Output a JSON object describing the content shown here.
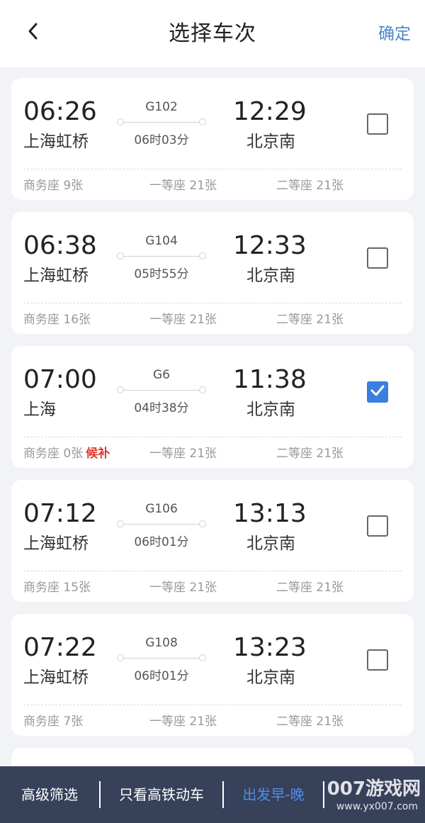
{
  "header": {
    "title": "选择车次",
    "confirm_label": "确定"
  },
  "trains": [
    {
      "dep_time": "06:26",
      "dep_station": "上海虹桥",
      "train_no": "G102",
      "duration": "06时03分",
      "arr_time": "12:29",
      "arr_station": "北京南",
      "checked": false,
      "seats": [
        "商务座 9张",
        "一等座 21张",
        "二等座 21张"
      ]
    },
    {
      "dep_time": "06:38",
      "dep_station": "上海虹桥",
      "train_no": "G104",
      "duration": "05时55分",
      "arr_time": "12:33",
      "arr_station": "北京南",
      "checked": false,
      "seats": [
        "商务座 16张",
        "一等座 21张",
        "二等座 21张"
      ]
    },
    {
      "dep_time": "07:00",
      "dep_station": "上海",
      "train_no": "G6",
      "duration": "04时38分",
      "arr_time": "11:38",
      "arr_station": "北京南",
      "checked": true,
      "seats": [
        "商务座 0张",
        "一等座 21张",
        "二等座 21张"
      ],
      "waitlist": "候补"
    },
    {
      "dep_time": "07:12",
      "dep_station": "上海虹桥",
      "train_no": "G106",
      "duration": "06时01分",
      "arr_time": "13:13",
      "arr_station": "北京南",
      "checked": false,
      "seats": [
        "商务座 15张",
        "一等座 21张",
        "二等座 21张"
      ]
    },
    {
      "dep_time": "07:22",
      "dep_station": "上海虹桥",
      "train_no": "G108",
      "duration": "06时01分",
      "arr_time": "13:23",
      "arr_station": "北京南",
      "checked": false,
      "seats": [
        "商务座 7张",
        "一等座 21张",
        "二等座 21张"
      ]
    }
  ],
  "bottom_bar": {
    "filters": [
      "高级筛选",
      "只看高铁动车",
      "出发早-晚"
    ],
    "active_index": 2
  },
  "watermark": {
    "text": "007游戏网",
    "url": "www.yx007.com"
  },
  "colors": {
    "accent": "#3a7ee0",
    "active_filter": "#4a8ff0",
    "waitlist": "#e03a2f",
    "bottom_bar": "#37415a"
  }
}
